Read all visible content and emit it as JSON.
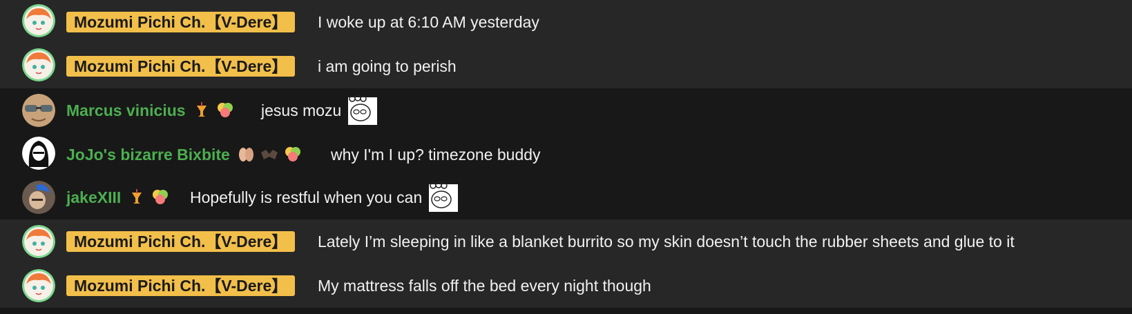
{
  "messages": [
    {
      "author": "Mozumi Pichi Ch.【V-Dere】",
      "text": "I woke up at 6:10 AM yesterday",
      "role": "owner"
    },
    {
      "author": "Mozumi Pichi Ch.【V-Dere】",
      "text": "i am going to perish",
      "role": "owner"
    },
    {
      "author": "Marcus vinicius",
      "text": "jesus mozu",
      "role": "member",
      "badges": [
        "cocktail-icon",
        "fruit-slice-icon"
      ],
      "sticker": "cat-sticker-icon"
    },
    {
      "author": "JoJo's bizarre Bixbite",
      "text": "why I'm I up? timezone buddy",
      "role": "member",
      "badges": [
        "ear-icon",
        "bat-icon",
        "fruit-slice-icon"
      ]
    },
    {
      "author": "jakeXIII",
      "text": "Hopefully is restful when you can",
      "role": "member",
      "badges": [
        "cocktail-icon",
        "fruit-slice-icon"
      ],
      "sticker": "cat-sticker-icon"
    },
    {
      "author": "Mozumi Pichi Ch.【V-Dere】",
      "text": "Lately I’m sleeping in like a blanket burrito so my skin doesn’t touch the rubber sheets and glue to it",
      "role": "owner"
    },
    {
      "author": "Mozumi Pichi Ch.【V-Dere】",
      "text": "My mattress falls off the bed every night though",
      "role": "owner"
    }
  ],
  "colors": {
    "owner_badge": "#f2bf4a",
    "member_name": "#4caf50",
    "text": "#f1f1f1"
  }
}
